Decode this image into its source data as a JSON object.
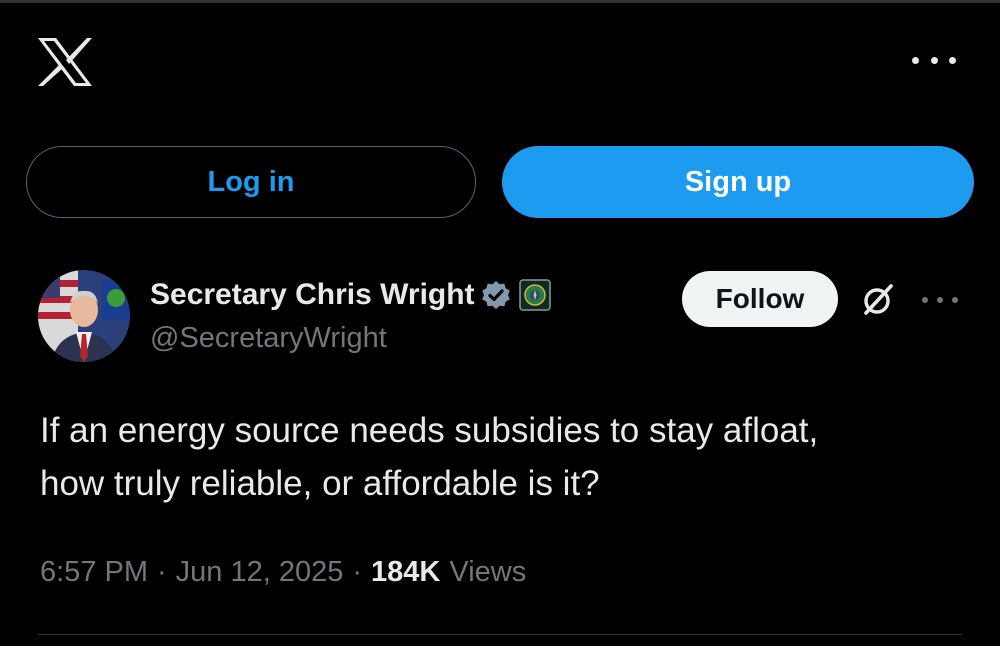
{
  "header": {
    "logo_icon": "x-logo-icon",
    "more_icon": "more-horizontal-icon"
  },
  "auth": {
    "login_label": "Log in",
    "signup_label": "Sign up"
  },
  "tweet": {
    "author": {
      "display_name": "Secretary Chris Wright",
      "handle": "@SecretaryWright",
      "verified_icon": "verified-badge-icon",
      "affiliate_icon": "department-of-energy-seal-icon"
    },
    "follow_label": "Follow",
    "grok_icon": "grok-icon",
    "more_icon": "more-horizontal-icon",
    "text_lines": [
      "If an energy source needs subsidies to stay afloat,",
      "how truly reliable, or affordable is it?"
    ],
    "time": "6:57 PM",
    "date": "Jun 12, 2025",
    "separator": "·",
    "views_count": "184K",
    "views_label": "Views"
  },
  "colors": {
    "background": "#000000",
    "accent": "#1d9bf0",
    "text_primary": "#e7e9ea",
    "text_secondary": "#71767b",
    "follow_bg": "#eff3f4",
    "border": "#536471"
  }
}
